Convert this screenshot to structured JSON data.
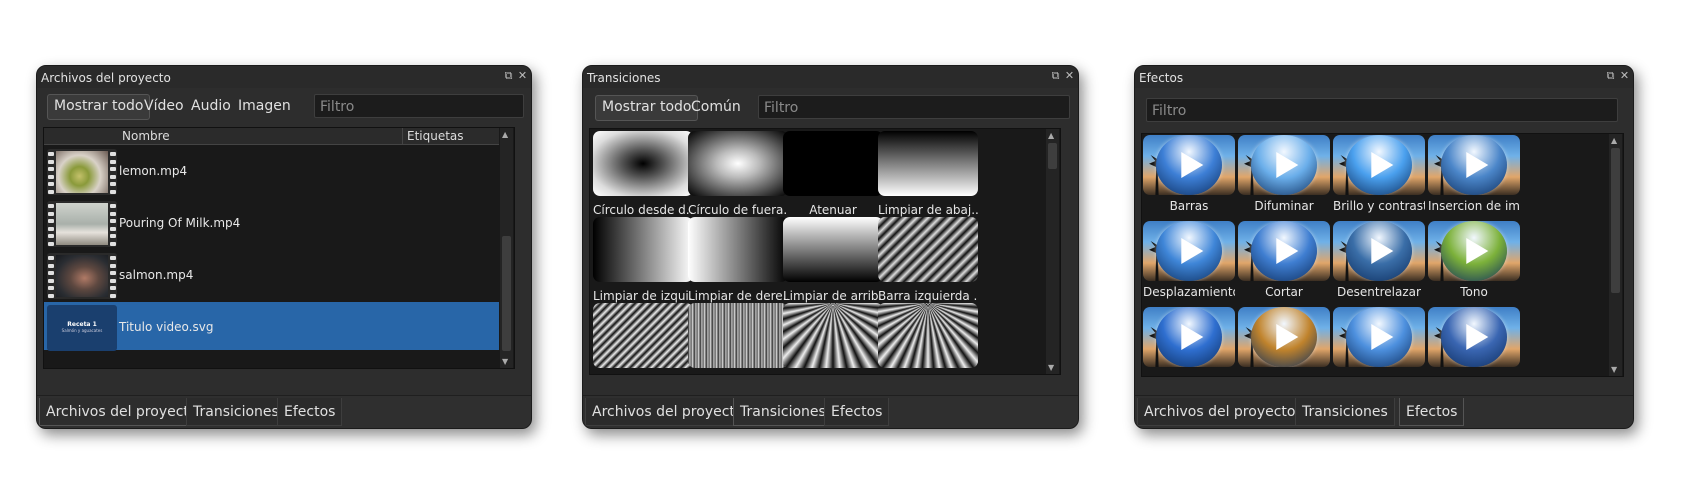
{
  "panels": {
    "project": {
      "title": "Archivos del proyecto",
      "buttons": [
        "Mostrar todo",
        "Vídeo",
        "Audio",
        "Imagen"
      ],
      "filter_placeholder": "Filtro",
      "columns": {
        "name": "Nombre",
        "tags": "Etiquetas"
      },
      "files": [
        {
          "name": "lemon.mp4",
          "thumb": "lemon"
        },
        {
          "name": "Pouring Of Milk.mp4",
          "thumb": "milk"
        },
        {
          "name": "salmon.mp4",
          "thumb": "salmon"
        },
        {
          "name": "Titulo video.svg",
          "thumb": "title",
          "selected": true,
          "thumb_text_1": "Receta 1",
          "thumb_text_2": "Salmón y aguacates"
        }
      ]
    },
    "transitions": {
      "title": "Transiciones",
      "buttons": [
        "Mostrar todo",
        "Común"
      ],
      "filter_placeholder": "Filtro",
      "items": [
        {
          "label": "Círculo desde d...",
          "pattern": "circle-in"
        },
        {
          "label": "Círculo de fuera...",
          "pattern": "circle-out"
        },
        {
          "label": "Atenuar",
          "pattern": "fade"
        },
        {
          "label": "Limpiar de abaj...",
          "pattern": "wipe-bottom"
        },
        {
          "label": "Limpiar de izqui...",
          "pattern": "wipe-left"
        },
        {
          "label": "Limpiar de dere...",
          "pattern": "wipe-right"
        },
        {
          "label": "Limpiar de arrib...",
          "pattern": "wipe-top"
        },
        {
          "label": "Barra izquierda ...",
          "pattern": "bars-left"
        },
        {
          "label": "",
          "pattern": "diag"
        },
        {
          "label": "",
          "pattern": "noise"
        },
        {
          "label": "",
          "pattern": "rays-1"
        },
        {
          "label": "",
          "pattern": "rays-2"
        }
      ]
    },
    "effects": {
      "title": "Efectos",
      "filter_placeholder": "Filtro",
      "items": [
        {
          "label": "Barras",
          "ball": "#3d7fd6"
        },
        {
          "label": "Difuminar",
          "ball": "#6aaeea"
        },
        {
          "label": "Brillo y contraste",
          "ball": "#4aa0ee"
        },
        {
          "label": "Insercion de im...",
          "ball": "#4b86c9"
        },
        {
          "label": "Desplazamiento...",
          "ball": "#3f86d8"
        },
        {
          "label": "Cortar",
          "ball": "#3f7ed1"
        },
        {
          "label": "Desentrelazar",
          "ball": "#3a6ea8"
        },
        {
          "label": "Tono",
          "ball": "#7cb13a"
        },
        {
          "label": "",
          "ball": "#2f6fd0"
        },
        {
          "label": "",
          "ball": "#c0832c"
        },
        {
          "label": "",
          "ball": "#4d90de"
        },
        {
          "label": "",
          "ball": "#3a66b2"
        }
      ]
    }
  },
  "tabs": [
    "Archivos del proyecto",
    "Transiciones",
    "Efectos"
  ],
  "icons": {
    "float": "float-icon",
    "close": "close-icon"
  },
  "colors": {
    "selection": "#2866a8",
    "panel": "#2d2d2d",
    "view": "#191919"
  }
}
